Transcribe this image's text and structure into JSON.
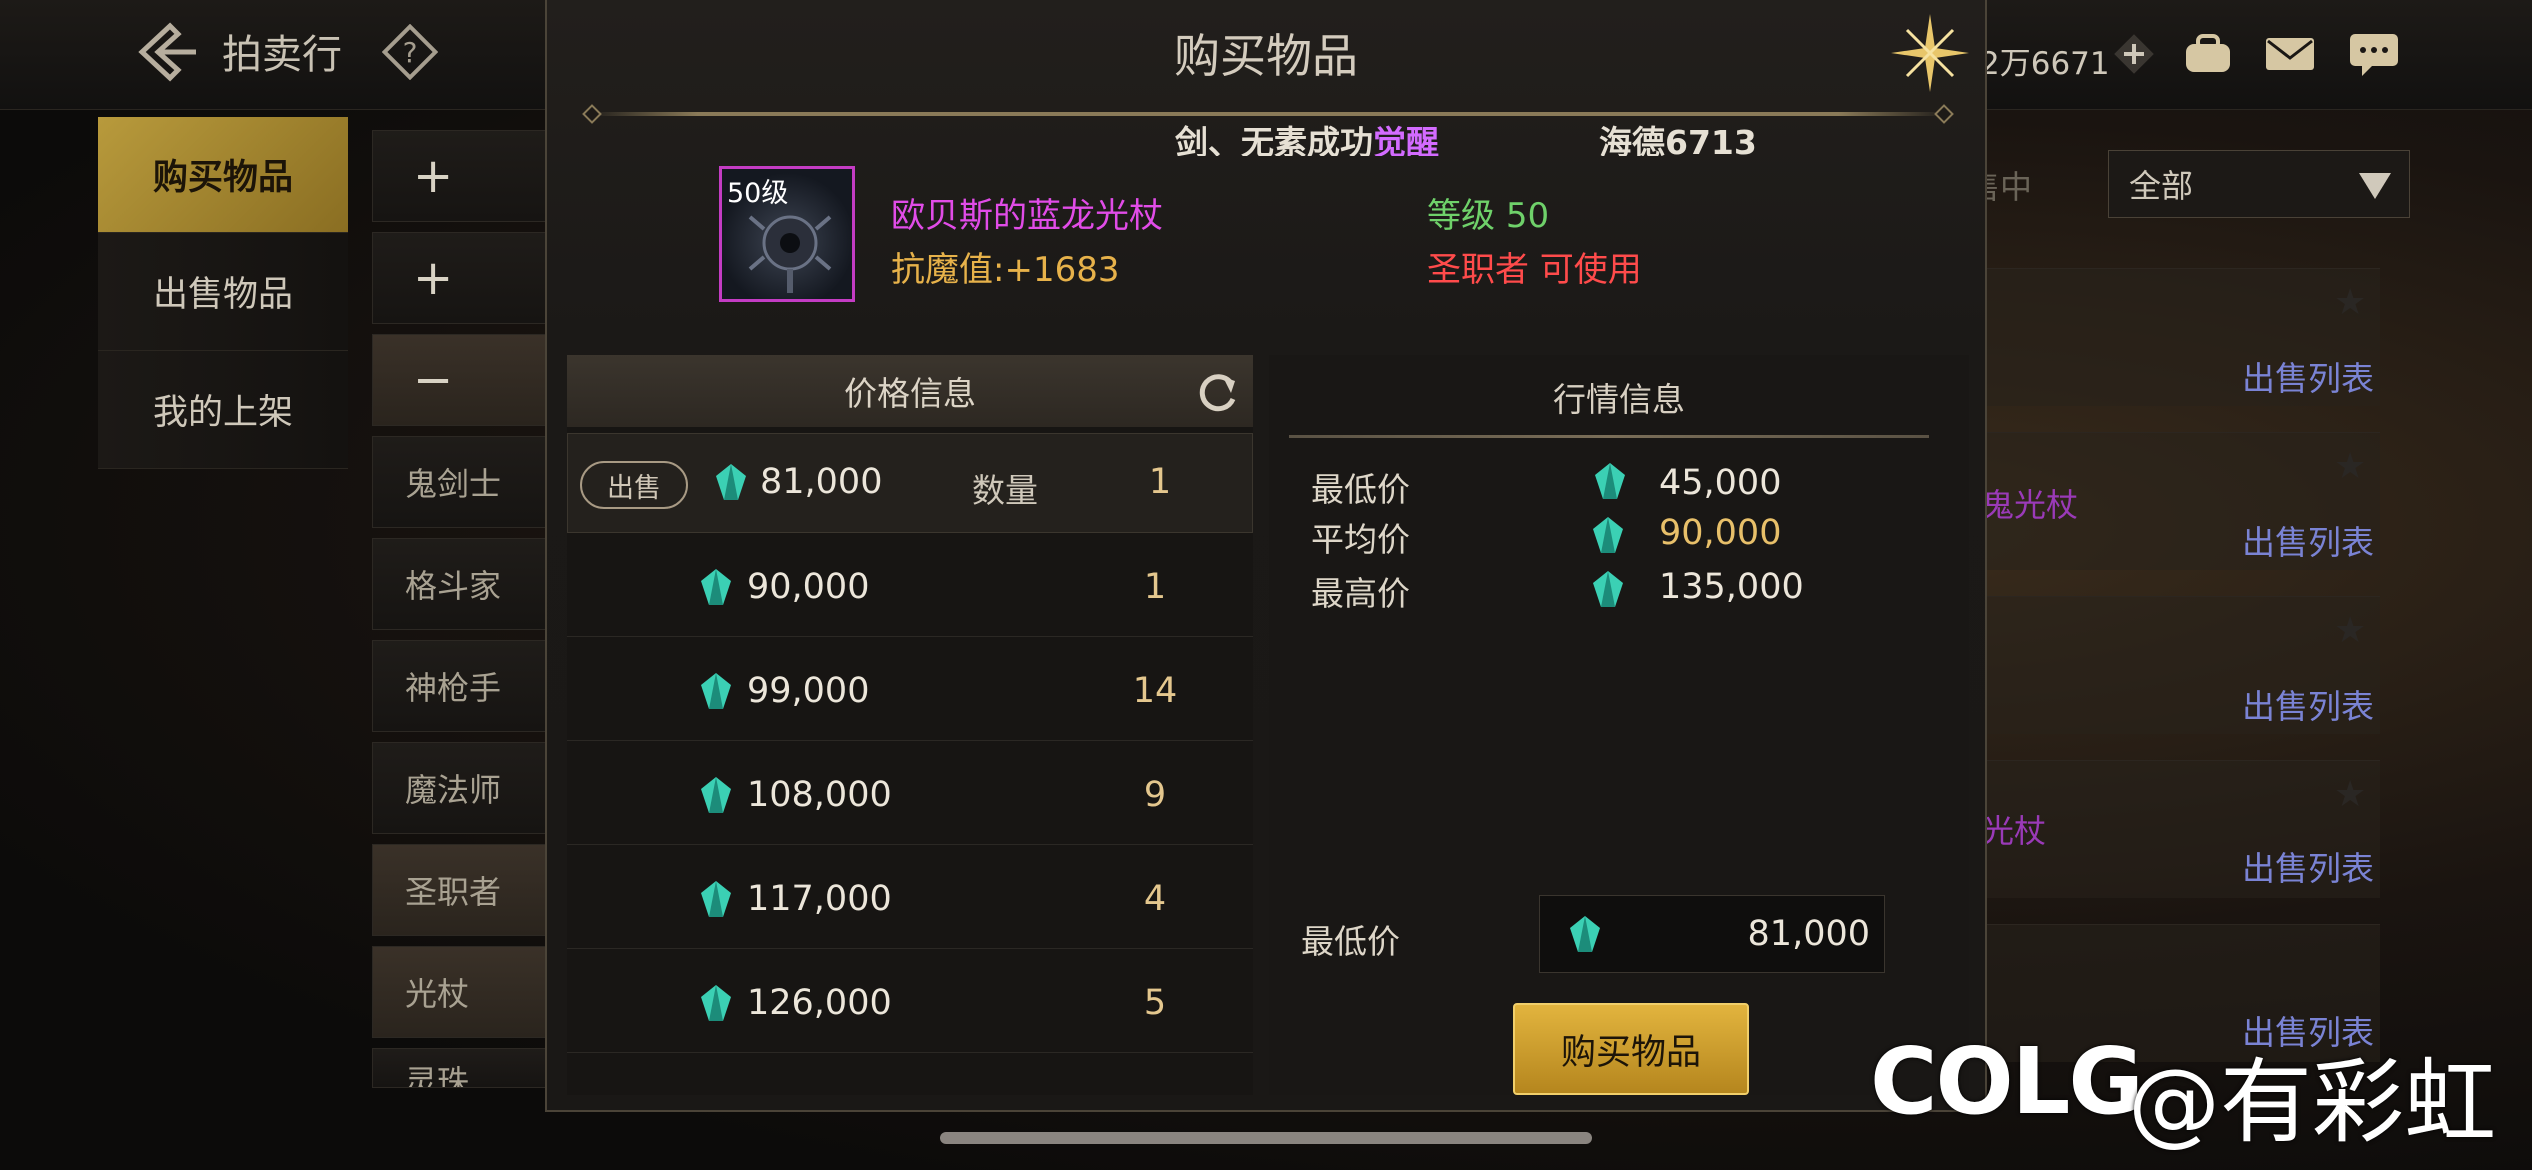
{
  "topbar": {
    "title": "拍卖行",
    "currency": "2万6671"
  },
  "tabs": [
    {
      "label": "购买物品",
      "active": true
    },
    {
      "label": "出售物品",
      "active": false
    },
    {
      "label": "我的上架",
      "active": false
    }
  ],
  "categories": [
    {
      "label": "+"
    },
    {
      "label": "+"
    },
    {
      "label": "−"
    },
    {
      "label": "鬼剑士"
    },
    {
      "label": "格斗家"
    },
    {
      "label": "神枪手"
    },
    {
      "label": "魔法师"
    },
    {
      "label": "圣职者"
    },
    {
      "label": "光杖"
    },
    {
      "label": "灵珠"
    }
  ],
  "background": {
    "filter_label": "全部",
    "status_label": "售中",
    "sell_list_label": "出售列表",
    "partial_items": [
      "鬼光杖",
      "光杖"
    ]
  },
  "modal": {
    "title": "购买物品",
    "ticker": {
      "part1": "剑、无素成功",
      "part1_highlight": "觉醒",
      "part2": "海德6713"
    },
    "item": {
      "level_badge": "50级",
      "name": "欧贝斯的蓝龙光杖",
      "stat": "抗魔值:+1683",
      "level_label": "等级",
      "level_value": "50",
      "usable": "圣职者 可使用"
    },
    "price_panel": {
      "title": "价格信息",
      "sell_badge": "出售",
      "qty_label": "数量",
      "listings": [
        {
          "price": "81,000",
          "qty": "1"
        },
        {
          "price": "90,000",
          "qty": "1"
        },
        {
          "price": "99,000",
          "qty": "14"
        },
        {
          "price": "108,000",
          "qty": "9"
        },
        {
          "price": "117,000",
          "qty": "4"
        },
        {
          "price": "126,000",
          "qty": "5"
        }
      ]
    },
    "market_panel": {
      "title": "行情信息",
      "lowest_label": "最低价",
      "lowest": "45,000",
      "average_label": "平均价",
      "average": "90,000",
      "highest_label": "最高价",
      "highest": "135,000",
      "buy_min_label": "最低价",
      "buy_min_value": "81,000",
      "buy_button": "购买物品"
    }
  },
  "watermark": {
    "brand": "COLG",
    "user": "@有彩虹"
  },
  "colors": {
    "gold": "#e2b43e",
    "purple": "#e14ce8",
    "green": "#6fd16a",
    "red": "#ff4b4b",
    "link": "#7a83d4"
  }
}
